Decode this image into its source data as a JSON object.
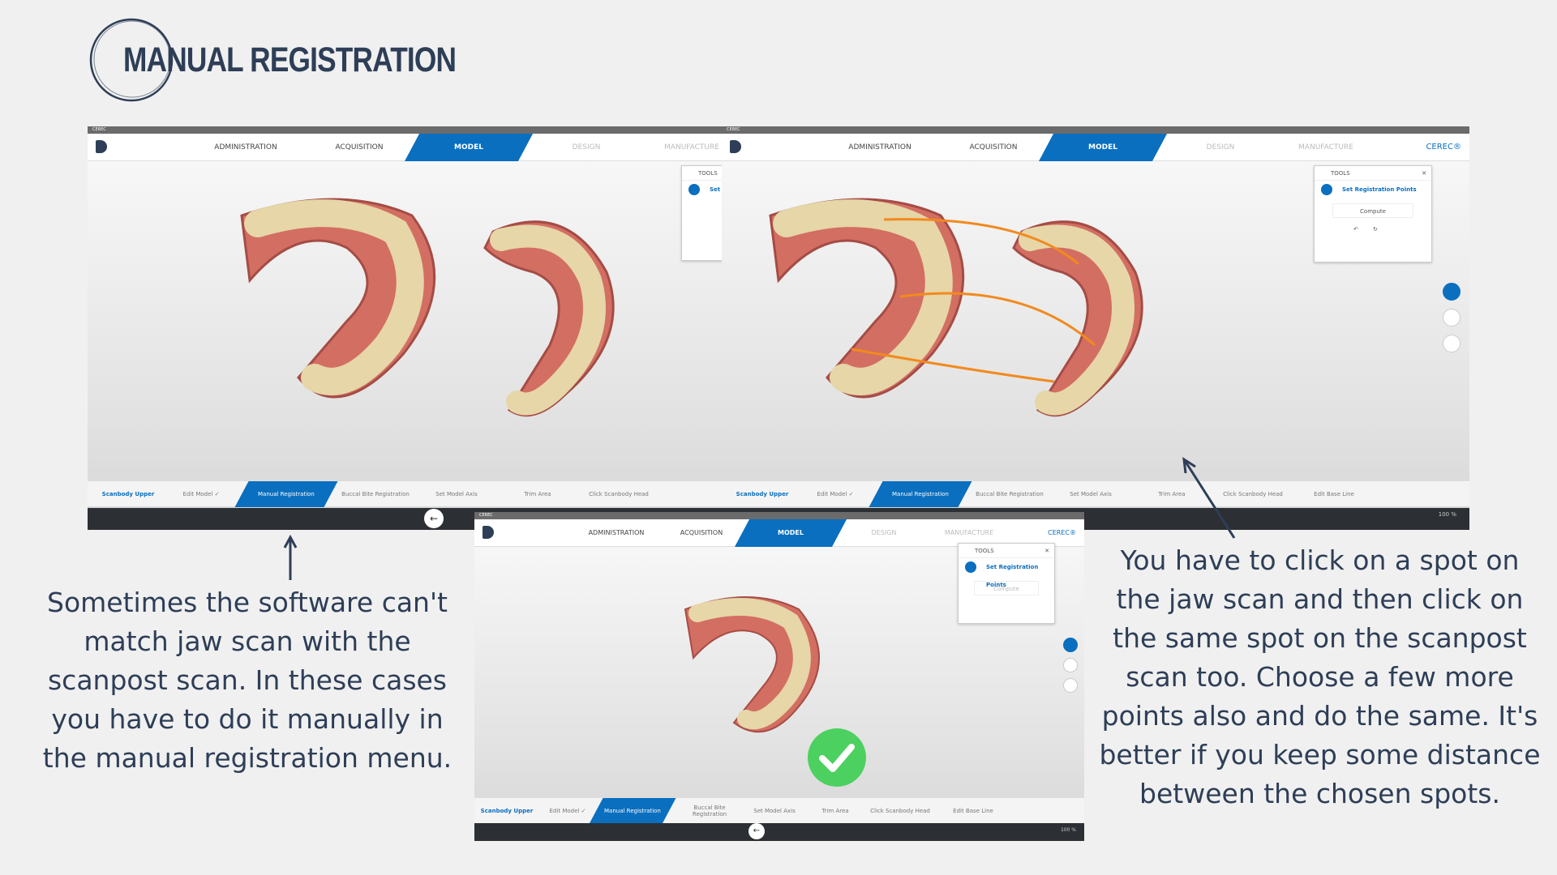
{
  "header": {
    "title": "MANUAL REGISTRATION"
  },
  "app": {
    "window_title": "CEREC",
    "brand": "CEREC®",
    "nav_tabs": [
      "ADMINISTRATION",
      "ACQUISITION",
      "MODEL",
      "DESIGN",
      "MANUFACTURE"
    ],
    "active_tab": "MODEL",
    "steps": [
      {
        "label": "Scanbody Upper"
      },
      {
        "label": "Edit Model ✓"
      },
      {
        "label": "Manual Registration"
      },
      {
        "label": "Buccal Bite Registration"
      },
      {
        "label": "Set Model Axis"
      },
      {
        "label": "Trim Area"
      },
      {
        "label": "Click Scanbody Head"
      },
      {
        "label": "Edit Base Line"
      }
    ],
    "tools": {
      "title": "TOOLS",
      "item": "Set Registration Points",
      "item_truncated": "Set",
      "compute": "Compute",
      "undo": "↶",
      "redo": "↻",
      "close": "✕"
    },
    "zoom": "100 %"
  },
  "captions": {
    "left": "Sometimes the software can't match jaw scan with the scanpost scan.  In these cases you have to do it manually in the manual registration menu.",
    "right": "You have to click on a spot on the jaw scan and then click on the same spot on the scanpost scan too. Choose a few more points also and do the same. It's better if you keep some distance between the chosen spots."
  },
  "colors": {
    "accent": "#0a6fbf",
    "text": "#2e3e57",
    "registration_line": "#f28a1e",
    "success": "#4cd060"
  }
}
